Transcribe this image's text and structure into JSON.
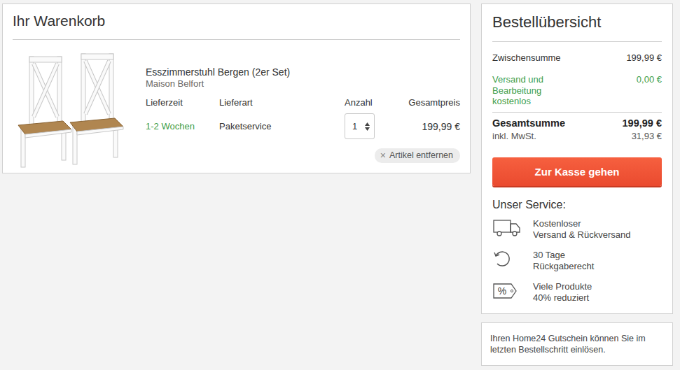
{
  "cart": {
    "title": "Ihr Warenkorb",
    "columns": [
      "Lieferzeit",
      "Lieferart",
      "Anzahl",
      "Gesamtpreis"
    ],
    "items": [
      {
        "name": "Esszimmerstuhl Bergen (2er Set)",
        "brand": "Maison Belfort",
        "delivery_time": "1-2 Wochen",
        "delivery_type": "Paketservice",
        "quantity": "1",
        "total": "199,99 €",
        "remove": {
          "icon": "×",
          "label": "Artikel entfernen"
        }
      }
    ]
  },
  "summary": {
    "title": "Bestellübersicht",
    "rows": [
      {
        "label": [
          "Zwischensumme"
        ],
        "value": "199,99 €",
        "kind": "normal"
      },
      {
        "label": [
          "Versand und",
          "Bearbeitung",
          "kostenlos"
        ],
        "value": "0,00 €",
        "kind": "highlight"
      }
    ],
    "total": {
      "label": "Gesamtsumme",
      "value": "199,99 €"
    },
    "tax": {
      "label": "inkl. MwSt.",
      "value": "31,93 €"
    },
    "checkout_button": "Zur Kasse gehen"
  },
  "service": {
    "title": "Unser Service:",
    "items": [
      {
        "kind": "shipping",
        "lines": [
          "Kostenloser",
          "Versand & Rückversand"
        ]
      },
      {
        "kind": "returns",
        "lines": [
          "30 Tage",
          "Rückgaberecht"
        ]
      },
      {
        "kind": "discount",
        "badge": "%",
        "lines": [
          "Viele Produkte",
          "40% reduziert"
        ]
      }
    ]
  },
  "voucher_note": {
    "lines": [
      "Ihren Home24 Gutschein können Sie im",
      "letzten Bestellschritt einlösen."
    ]
  }
}
